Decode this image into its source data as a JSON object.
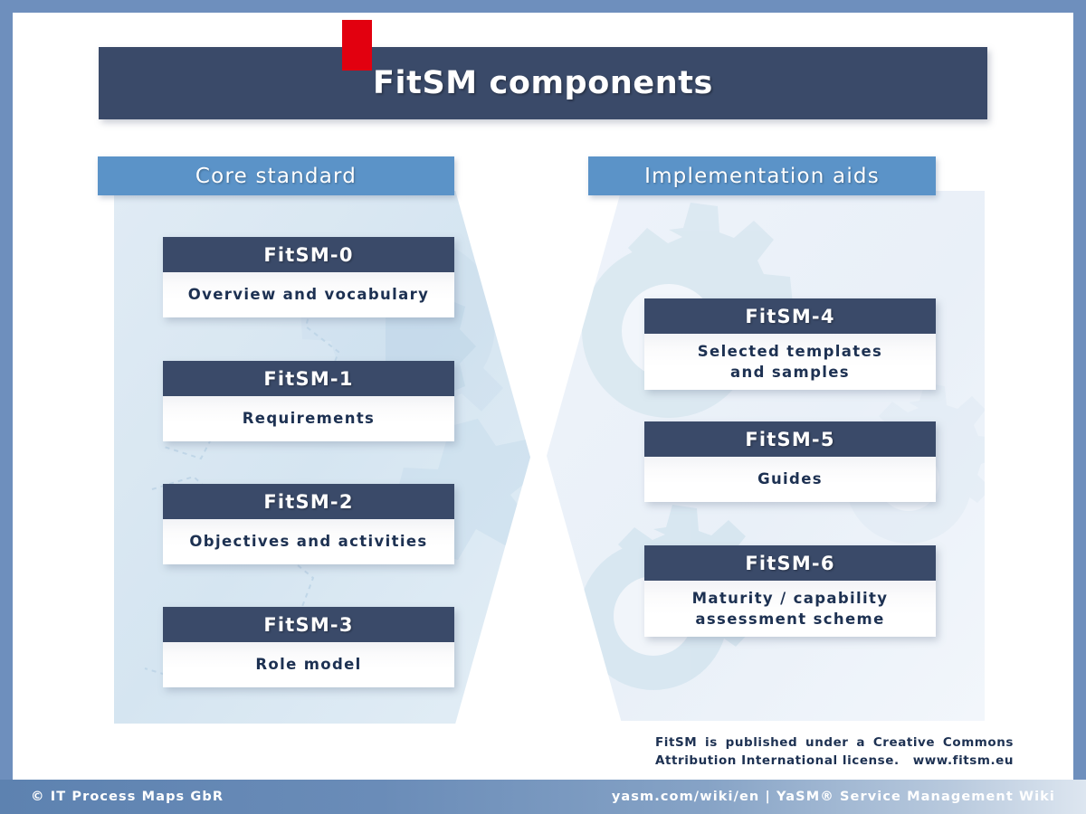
{
  "title": {
    "text": "FitSM components"
  },
  "accent": {
    "red_tab": "red-accent-tab",
    "colors": {
      "dark_navy": "#3a4a69",
      "mid_blue": "#5b93c8",
      "frame_blue": "#6e8fbd",
      "accent_red": "#e2000f",
      "body_text": "#1d3152",
      "panel_left_bg": "#d9e7f2",
      "panel_right_bg": "#eef3fa"
    }
  },
  "columns": [
    {
      "id": "core-standard",
      "header": "Core standard",
      "cards": [
        {
          "title": "FitSM-0",
          "body": "Overview and vocabulary"
        },
        {
          "title": "FitSM-1",
          "body": "Requirements"
        },
        {
          "title": "FitSM-2",
          "body": "Objectives and activities"
        },
        {
          "title": "FitSM-3",
          "body": "Role model"
        }
      ]
    },
    {
      "id": "implementation-aids",
      "header": "Implementation aids",
      "cards": [
        {
          "title": "FitSM-4",
          "body": "Selected templates\nand samples"
        },
        {
          "title": "FitSM-5",
          "body": "Guides"
        },
        {
          "title": "FitSM-6",
          "body": "Maturity / capability\nassessment scheme"
        }
      ]
    }
  ],
  "license": {
    "line1": "FitSM is published under a Creative Commons",
    "line2_left": "Attribution International license.",
    "line2_right": "www.fitsm.eu"
  },
  "footer": {
    "left": "© IT Process Maps GbR",
    "right": "yasm.com/wiki/en | YaSM® Service Management Wiki"
  }
}
